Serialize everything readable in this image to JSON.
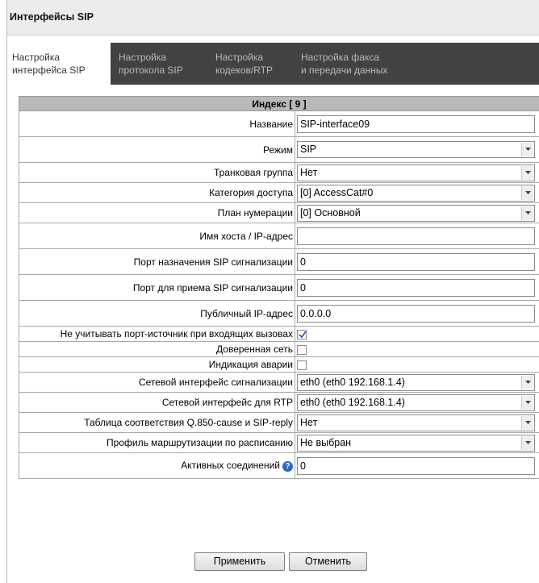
{
  "window": {
    "title": "Интерфейсы SIP"
  },
  "tabs": [
    {
      "line1": "Настройка",
      "line2": "интерфейса SIP",
      "active": true
    },
    {
      "line1": "Настройка",
      "line2": "протокола SIP",
      "active": false
    },
    {
      "line1": "Настройка",
      "line2": "кодеков/RTP",
      "active": false
    },
    {
      "line1": "Настройка факса",
      "line2": "и передачи данных",
      "active": false
    }
  ],
  "form": {
    "header": "Индекс [ 9 ]",
    "name": {
      "label": "Название",
      "value": "SIP-interface09"
    },
    "mode": {
      "label": "Режим",
      "value": "SIP"
    },
    "trunk_group": {
      "label": "Транковая группа",
      "value": "Нет"
    },
    "access_category": {
      "label": "Категория доступа",
      "value": "[0] AccessCat#0"
    },
    "numbering_plan": {
      "label": "План нумерации",
      "value": "[0] Основной"
    },
    "host": {
      "label": "Имя хоста / IP-адрес",
      "value": ""
    },
    "sip_dest_port": {
      "label": "Порт назначения SIP сигнализации",
      "value": "0"
    },
    "sip_recv_port": {
      "label": "Порт для приема SIP сигнализации",
      "value": "0"
    },
    "public_ip": {
      "label": "Публичный IP-адрес",
      "value": "0.0.0.0"
    },
    "ignore_src_port": {
      "label": "Не учитывать порт-источник при входящих вызовах",
      "checked": true
    },
    "trusted_network": {
      "label": "Доверенная сеть",
      "checked": false
    },
    "alarm_indication": {
      "label": "Индикация аварии",
      "checked": false
    },
    "signal_iface": {
      "label": "Сетевой интерфейс сигнализации",
      "value": "eth0 (eth0 192.168.1.4)"
    },
    "rtp_iface": {
      "label": "Сетевой интерфейс для RTP",
      "value": "eth0 (eth0 192.168.1.4)"
    },
    "q850_table": {
      "label": "Таблица соответствия Q.850-cause и SIP-reply",
      "value": "Нет"
    },
    "schedule_profile": {
      "label": "Профиль маршрутизации по расписанию",
      "value": "Не выбран"
    },
    "active_connections": {
      "label": "Активных соединений",
      "value": "0"
    }
  },
  "buttons": {
    "apply": "Применить",
    "cancel": "Отменить"
  },
  "icons": {
    "help": "help-icon",
    "dropdown": "chevron-down-icon",
    "check": "checkmark-icon"
  },
  "colors": {
    "tab_bar": "#424242",
    "header_row": "#b9b9b9",
    "help_icon": "#2a66c9"
  }
}
